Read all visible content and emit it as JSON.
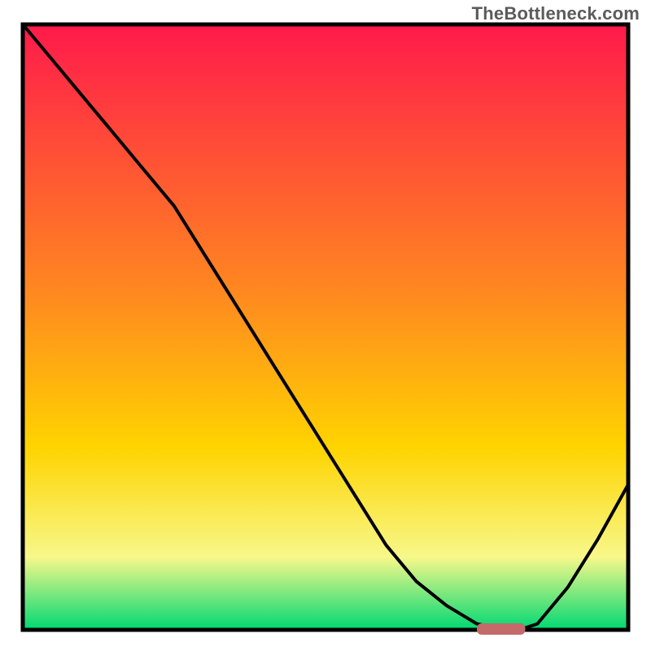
{
  "watermark": "TheBottleneck.com",
  "chart_data": {
    "type": "line",
    "title": "",
    "xlabel": "",
    "ylabel": "",
    "xlim": [
      0,
      100
    ],
    "ylim": [
      0,
      100
    ],
    "x": [
      0,
      5,
      10,
      15,
      20,
      25,
      30,
      35,
      40,
      45,
      50,
      55,
      60,
      65,
      70,
      75,
      80,
      82,
      85,
      90,
      95,
      100
    ],
    "y": [
      100,
      94,
      88,
      82,
      76,
      70,
      62,
      54,
      46,
      38,
      30,
      22,
      14,
      8,
      4,
      1,
      0,
      0,
      1,
      7,
      15,
      24
    ],
    "marker": {
      "x_start": 75,
      "x_end": 83,
      "y": 0
    },
    "colors": {
      "top": "#ff1a4b",
      "mid": "#ffd400",
      "bottom": "#00d873",
      "frame": "#000000",
      "line": "#000000",
      "marker": "#c46a6a"
    }
  }
}
